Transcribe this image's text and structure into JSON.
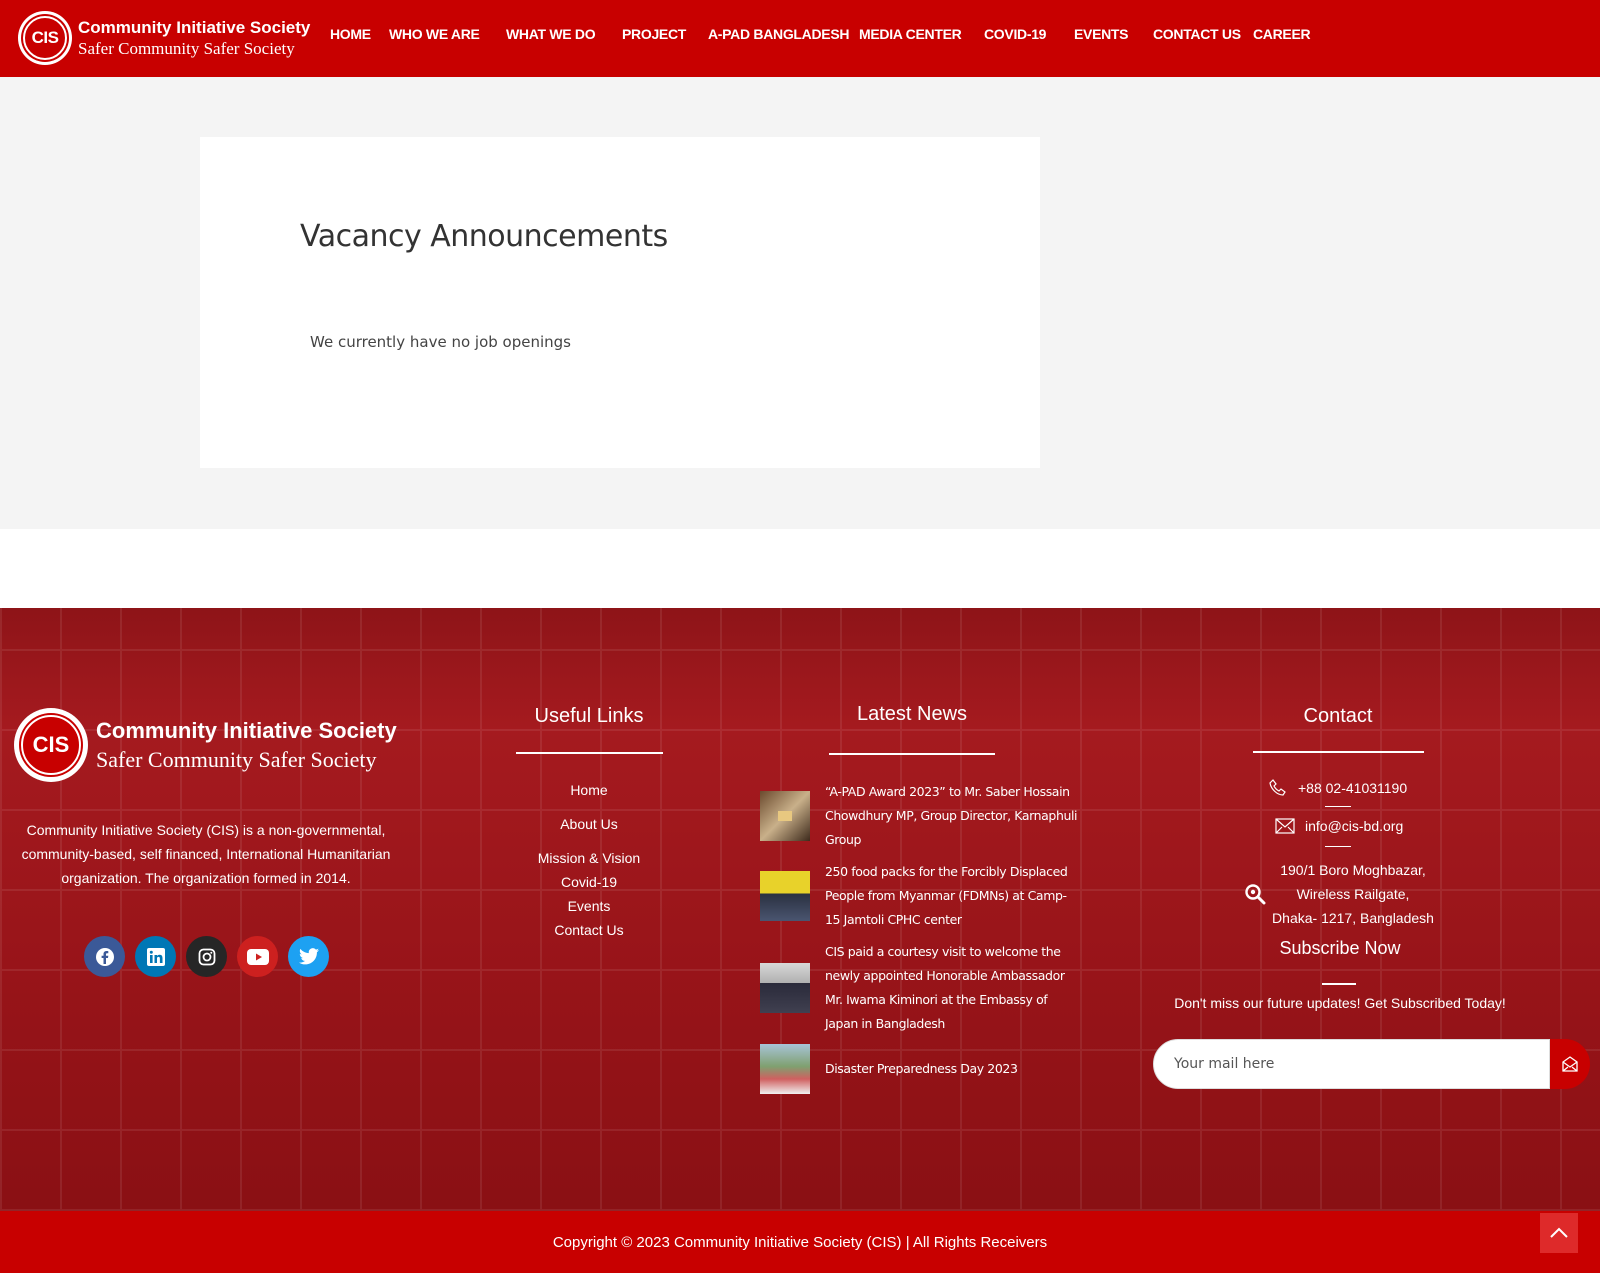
{
  "header": {
    "logo_abbr": "CIS",
    "logo_name": "Community Initiative Society",
    "logo_tagline": "Safer Community Safer Society",
    "nav": [
      {
        "label": "HOME"
      },
      {
        "label": "WHO WE ARE"
      },
      {
        "label": "WHAT WE DO"
      },
      {
        "label": "PROJECT"
      },
      {
        "label": "A-PAD BANGLADESH"
      },
      {
        "label": "MEDIA CENTER"
      },
      {
        "label": "COVID-19"
      },
      {
        "label": "EVENTS"
      },
      {
        "label": "CONTACT US"
      },
      {
        "label": "CAREER"
      }
    ]
  },
  "main": {
    "title": "Vacancy Announcements",
    "message": "We currently have no job openings"
  },
  "footer": {
    "logo_abbr": "CIS",
    "logo_name": "Community Initiative Society",
    "logo_tagline": "Safer Community Safer Society",
    "about": "Community Initiative Society (CIS) is a non-governmental, community-based, self financed, International Humanitarian organization. The organization formed in 2014.",
    "socials": [
      {
        "name": "facebook-icon",
        "color": "#3b5998"
      },
      {
        "name": "linkedin-icon",
        "color": "#0077b5"
      },
      {
        "name": "instagram-icon",
        "color": "#262626"
      },
      {
        "name": "youtube-icon",
        "color": "#cd201f"
      },
      {
        "name": "twitter-icon",
        "color": "#1da1f2"
      }
    ],
    "useful_links_title": "Useful Links",
    "useful_links": [
      {
        "label": "Home"
      },
      {
        "label": "About Us"
      },
      {
        "label": "Mission & Vision"
      },
      {
        "label": "Covid-19"
      },
      {
        "label": "Events"
      },
      {
        "label": "Contact Us"
      }
    ],
    "latest_news_title": "Latest News",
    "news": [
      {
        "title": "“A-PAD Award 2023” to Mr. Saber Hossain Chowdhury MP, Group Director, Karnaphuli Group"
      },
      {
        "title": "250 food packs for the Forcibly Displaced People from Myanmar (FDMNs) at Camp-15 Jamtoli CPHC center"
      },
      {
        "title": "CIS paid a courtesy visit to welcome the newly appointed Honorable Ambassador Mr. Iwama Kiminori at the Embassy of Japan in Bangladesh"
      },
      {
        "title": "Disaster Preparedness Day 2023"
      }
    ],
    "contact_title": "Contact",
    "phone": "+88 02-41031190",
    "email": "info@cis-bd.org",
    "address_lines": [
      "190/1 Boro Moghbazar,",
      "Wireless Railgate,",
      "Dhaka- 1217, Bangladesh"
    ],
    "subscribe_title": "Subscribe Now",
    "subscribe_text": "Don't miss our future updates! Get Subscribed Today!",
    "subscribe_placeholder": "Your mail here",
    "copyright": "Copyright © 2023 Community Initiative Society (CIS) | All Rights Receivers"
  },
  "colors": {
    "brand_red": "#c80000",
    "footer_red": "#9b171c"
  }
}
